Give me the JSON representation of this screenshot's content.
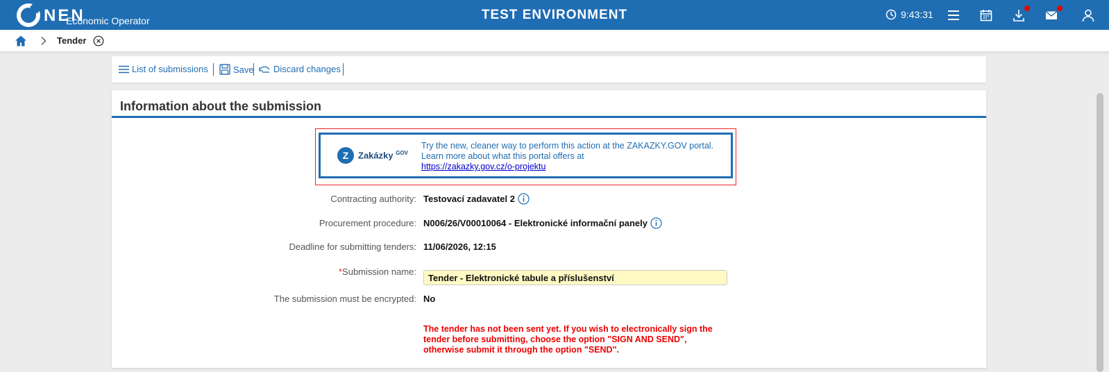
{
  "header": {
    "logo_text": "NEN",
    "logo_subtitle": "Economic Operator",
    "environment": "TEST ENVIRONMENT",
    "time": "9:43:31"
  },
  "breadcrumb": {
    "current": "Tender"
  },
  "toolbar": {
    "list_label": "List of submissions",
    "save_label": "Save",
    "discard_label": "Discard changes"
  },
  "section": {
    "title": "Information about the submission"
  },
  "promo": {
    "brand": "Zakázky",
    "brand_suffix": "GOV",
    "line1": "Try the new, cleaner way to perform this action at the ZAKAZKY.GOV portal.",
    "line2": "Learn more about what this portal offers at",
    "link": "https://zakazky.gov.cz/o-projektu"
  },
  "fields": {
    "authority_label": "Contracting authority:",
    "authority_value": "Testovací zadavatel 2",
    "procedure_label": "Procurement procedure:",
    "procedure_value": "N006/26/V00010064 - Elektronické informační panely",
    "deadline_label": "Deadline for submitting tenders:",
    "deadline_value": "11/06/2026, 12:15",
    "name_required": "*",
    "name_label": "Submission name:",
    "name_value": "Tender - Elektronické tabule a příslušenství",
    "encrypt_label": "The submission must be encrypted:",
    "encrypt_value": "No"
  },
  "warning": "The tender has not been sent yet. If you wish to electronically sign the tender before submitting, choose the option \"SIGN AND SEND\", otherwise submit it through the option \"SEND\".",
  "colors": {
    "brand_blue": "#1f6db2",
    "warning_red": "#ee0000",
    "input_yellow": "#fff9c4"
  }
}
